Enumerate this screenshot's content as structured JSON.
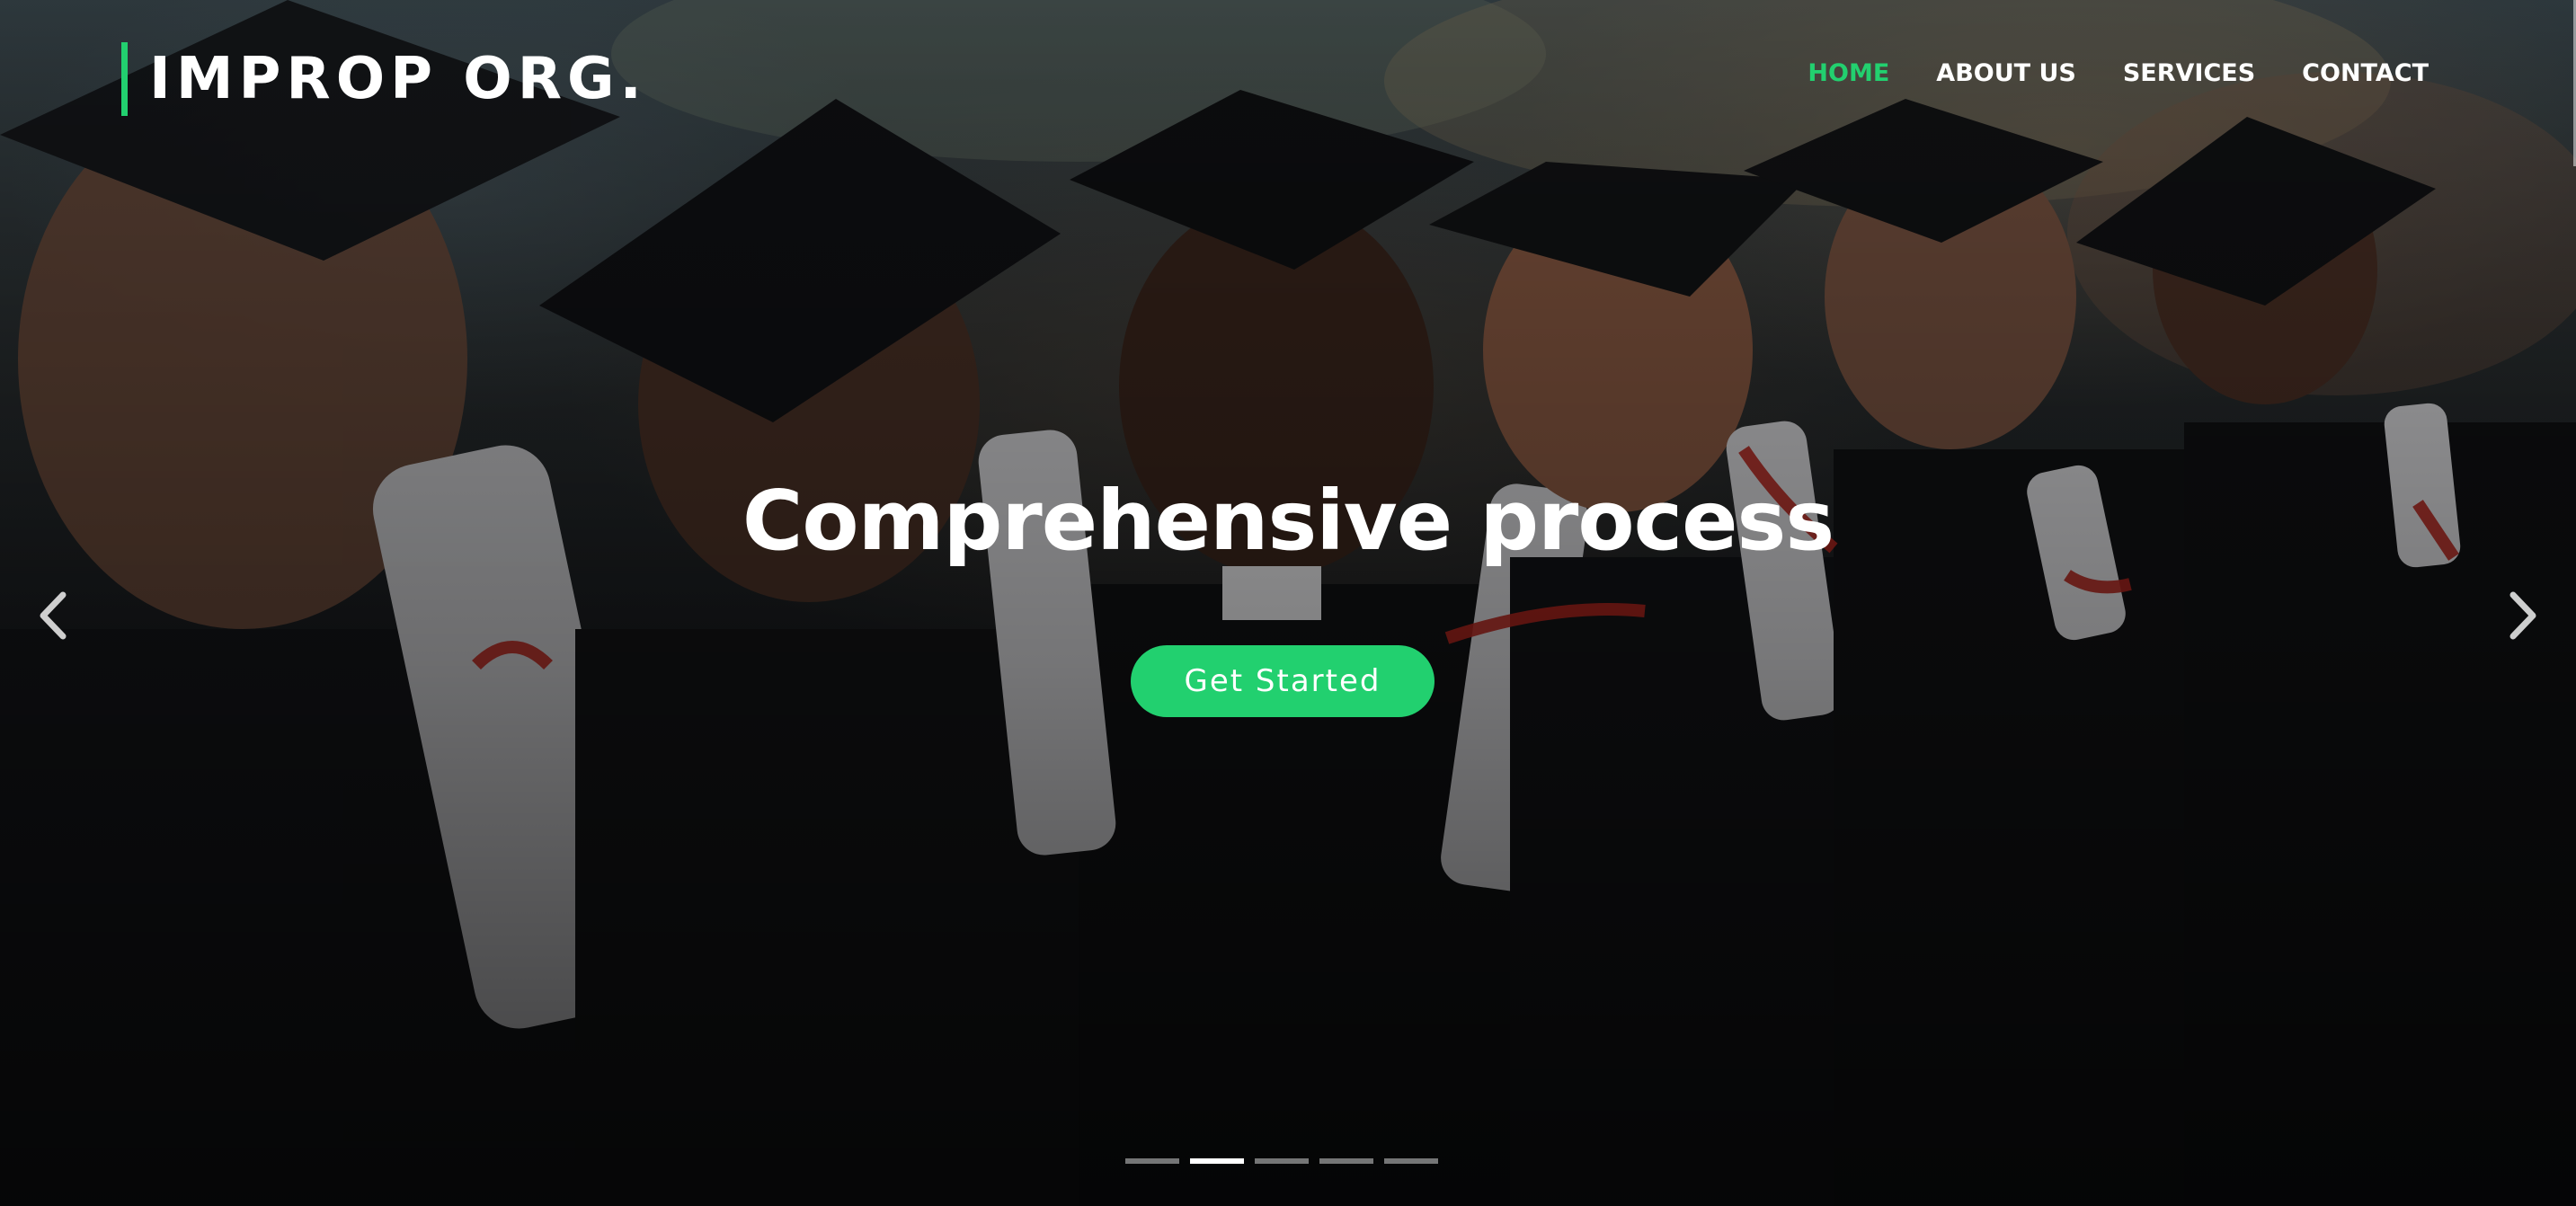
{
  "brand": {
    "name": "IMPROP ORG."
  },
  "nav": {
    "items": [
      {
        "label": "HOME",
        "active": true
      },
      {
        "label": "ABOUT US",
        "active": false
      },
      {
        "label": "SERVICES",
        "active": false
      },
      {
        "label": "CONTACT",
        "active": false
      }
    ]
  },
  "hero": {
    "title": "Comprehensive process",
    "cta_label": "Get Started",
    "background_icon": "graduates-photo"
  },
  "carousel": {
    "prev_icon": "chevron-left-icon",
    "next_icon": "chevron-right-icon",
    "slide_count": 5,
    "active_slide": 2
  },
  "colors": {
    "accent": "#22d06f",
    "text": "#ffffff"
  }
}
